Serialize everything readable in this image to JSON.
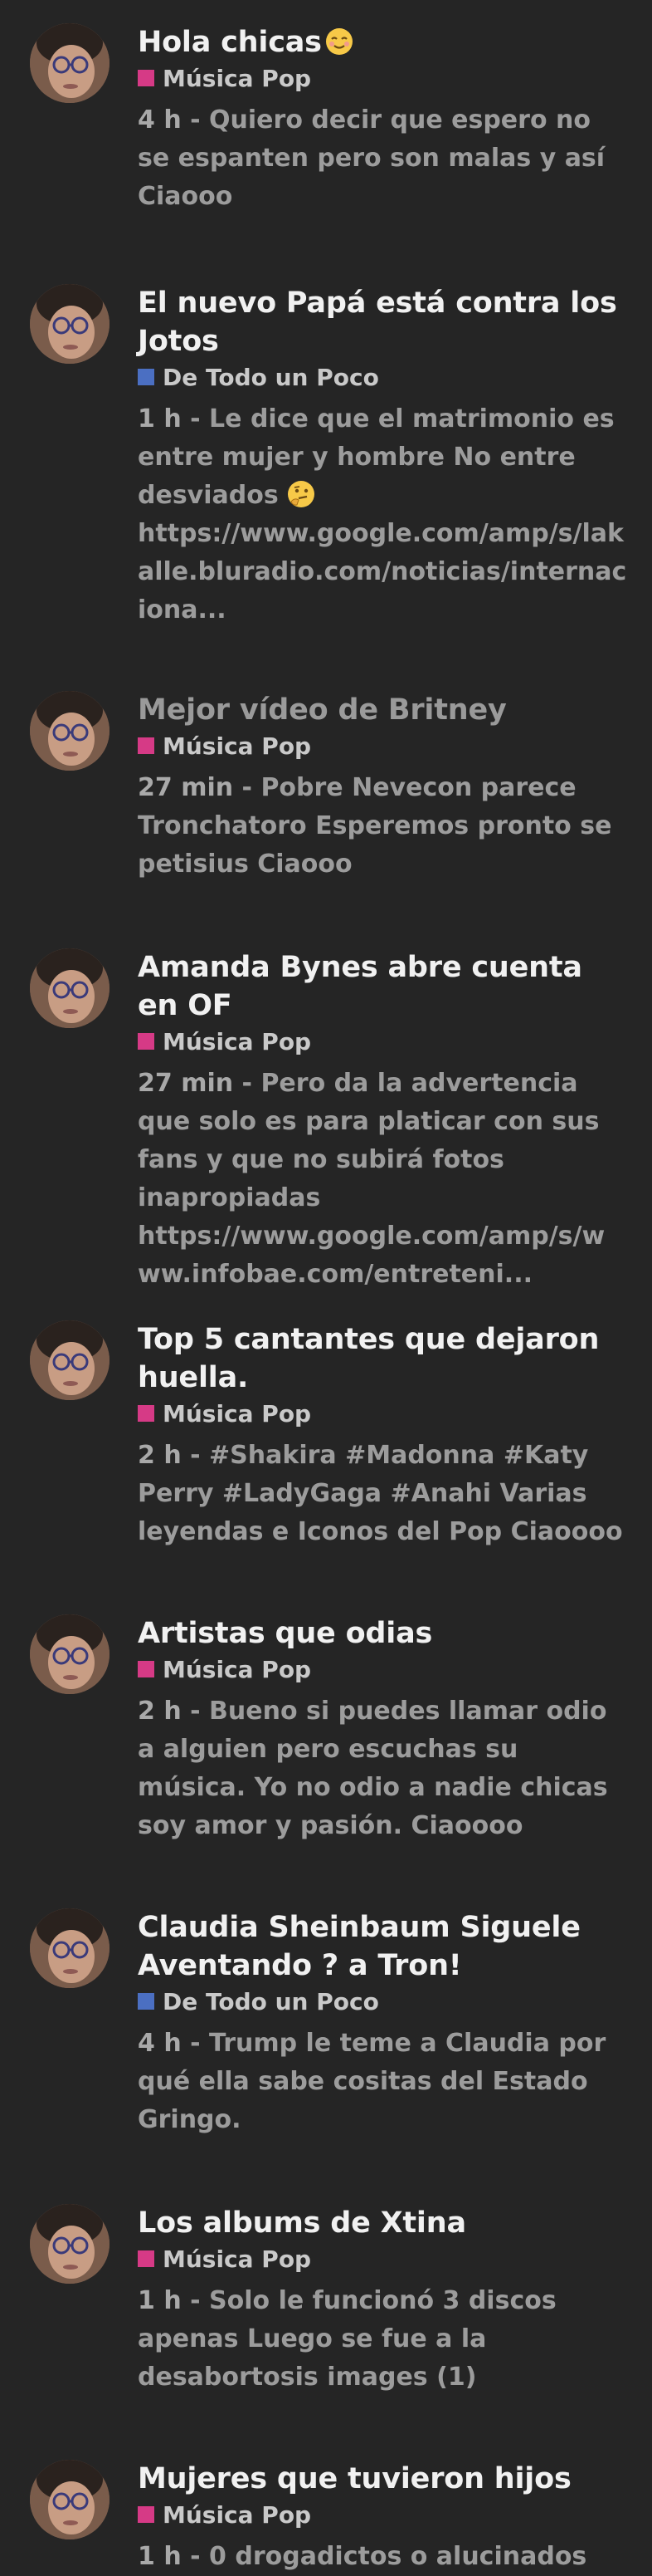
{
  "colors": {
    "background": "#252525",
    "musica_pop": "#d63a86",
    "de_todo": "#4b6fc2"
  },
  "topics": [
    {
      "title": "Hola chicas",
      "title_emoji": "relieved-face-emoji",
      "category": "Música Pop",
      "category_color": "#d63a86",
      "time": "4 h",
      "separator": " - ",
      "excerpt": "Quiero decir que espero no se espanten pero son malas y así Ciaooo"
    },
    {
      "title": "El nuevo Papá está contra los Jotos",
      "category": "De Todo un Poco",
      "category_color": "#4b6fc2",
      "time": "1 h",
      "separator": " - ",
      "excerpt_before_emoji": "Le dice que el matrimonio es entre mujer y hombre No entre desviados",
      "excerpt_emoji": "thinking-face-emoji",
      "excerpt_after_emoji": "https://www.google.com/amp/s/lakalle.bluradio.com/noticias/internaciona..."
    },
    {
      "title": "Mejor vídeo de Britney",
      "category": "Música Pop",
      "category_color": "#d63a86",
      "time": "27 min",
      "separator": " - ",
      "excerpt": "Pobre Nevecon parece Tronchatoro Esperemos pronto se petisius Ciaooo"
    },
    {
      "title": "Amanda Bynes abre cuenta en OF",
      "category": "Música Pop",
      "category_color": "#d63a86",
      "time": "27 min",
      "separator": " - ",
      "excerpt": "Pero da la advertencia que solo es para platicar con sus fans y que no subirá fotos inapropiadas https://www.google.com/amp/s/www.infobae.com/entreteni..."
    },
    {
      "title": "Top 5 cantantes que dejaron huella.",
      "category": "Música Pop",
      "category_color": "#d63a86",
      "time": "2 h",
      "separator": " - ",
      "excerpt": "#Shakira #Madonna #Katy Perry #LadyGaga #Anahi Varias leyendas e Iconos del Pop Ciaoooo"
    },
    {
      "title": "Artistas que odias",
      "category": "Música Pop",
      "category_color": "#d63a86",
      "time": "2 h",
      "separator": " - ",
      "excerpt": "Bueno si puedes llamar odio a alguien pero escuchas su música. Yo no odio a nadie chicas soy amor y pasión. Ciaoooo"
    },
    {
      "title": "Claudia Sheinbaum Siguele Aventando ? a Tron!",
      "category": "De Todo un Poco",
      "category_color": "#4b6fc2",
      "time": "4 h",
      "separator": " - ",
      "excerpt": "Trump le teme a Claudia por qué ella sabe cositas del Estado Gringo."
    },
    {
      "title": "Los albums de Xtina",
      "category": "Música Pop",
      "category_color": "#d63a86",
      "time": "1 h",
      "separator": " - ",
      "excerpt": "Solo le funcionó 3 discos apenas Luego se fue a la desabortosis images (1)"
    },
    {
      "title": "Mujeres que tuvieron hijos",
      "category": "Música Pop",
      "category_color": "#d63a86",
      "time": "1 h",
      "separator": " - ",
      "excerpt": "0 drogadictos o alucinados"
    }
  ]
}
